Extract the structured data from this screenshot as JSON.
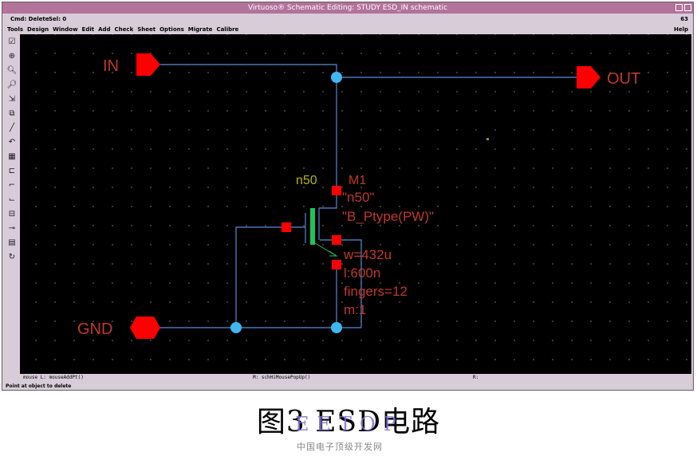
{
  "window": {
    "title": "Virtuoso® Schematic Editing: STUDY ESD_IN schematic",
    "status_cmd": "Cmd: Delete",
    "status_sel": "Sel: 0",
    "status_num": "63"
  },
  "menu": {
    "items": [
      "Tools",
      "Design",
      "Window",
      "Edit",
      "Add",
      "Check",
      "Sheet",
      "Options",
      "Migrate",
      "Calibre"
    ],
    "help": "Help"
  },
  "toolbar": {
    "icons": [
      "check-icon",
      "download-icon",
      "zoom-in-icon",
      "zoom-out-icon",
      "stretch-icon",
      "copy-icon",
      "wire-icon",
      "undo-icon",
      "grid-icon",
      "select-icon",
      "route-icon",
      "route-alt-icon",
      "label-icon",
      "pin-icon",
      "save-icon",
      "refresh-icon"
    ]
  },
  "schematic": {
    "pins": {
      "in": "IN",
      "out": "OUT",
      "gnd": "GND"
    },
    "device": {
      "instance": "M1",
      "model_label": "n50",
      "model_quoted": "\"n50\"",
      "body": "\"B_Ptype(PW)\"",
      "params": [
        "w=432u",
        "l:600n",
        "fingers=12",
        "m:1"
      ]
    },
    "colors": {
      "wire": "#4a76b8",
      "pin": "#ff0000",
      "label": "#c0392b",
      "dot": "#3fb8f0",
      "device": "#1fc35a",
      "model": "#b8b800"
    }
  },
  "bottom": {
    "left": "mouse L: mouseAddPt()",
    "middle": "M: schHiMousePopUp()",
    "right": "R:",
    "prompt": "Point at object to delete"
  },
  "caption": "图3 ESD电路",
  "watermark": {
    "brand": "EETOP",
    "subtitle": "中国电子顶级开发网"
  }
}
